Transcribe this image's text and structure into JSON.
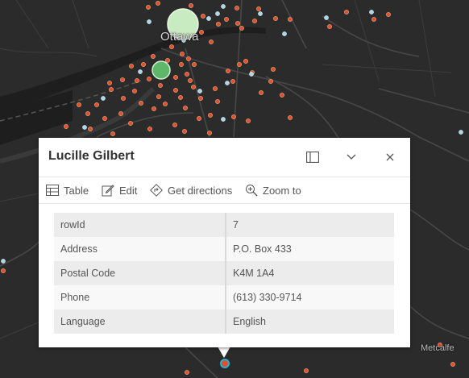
{
  "map": {
    "labels": {
      "city": "Ottawa",
      "town": "Metcalfe"
    },
    "colors": {
      "background": "#2b2b2b",
      "water": "#1f1f1f",
      "roads": "#454545",
      "point_orange": "#e0502a",
      "point_blue": "#a9d8e8",
      "cluster_light": "#c9ebc1",
      "cluster_green": "#5fb86a",
      "selection": "#1fb3d6"
    }
  },
  "popup": {
    "title": "Lucille Gilbert",
    "toolbar": {
      "table": "Table",
      "edit": "Edit",
      "directions": "Get directions",
      "zoom": "Zoom to"
    },
    "fields": [
      {
        "name": "rowId",
        "value": "7"
      },
      {
        "name": "Address",
        "value": "P.O. Box 433"
      },
      {
        "name": "Postal Code",
        "value": "K4M 1A4"
      },
      {
        "name": "Phone",
        "value": "(613) 330-9714"
      },
      {
        "name": "Language",
        "value": "English"
      }
    ]
  }
}
